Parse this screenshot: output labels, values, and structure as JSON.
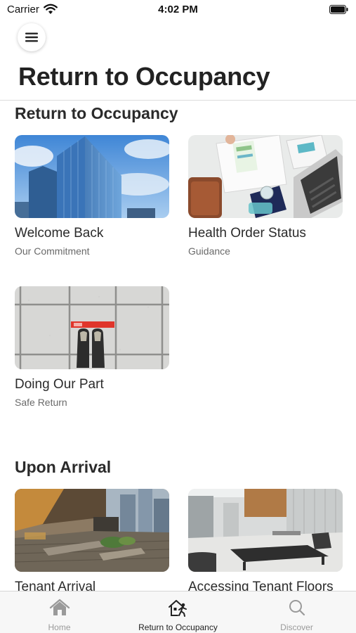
{
  "status_bar": {
    "carrier": "Carrier",
    "time": "4:02 PM"
  },
  "header": {
    "title": "Return to Occupancy",
    "menu_icon": "hamburger-menu-icon"
  },
  "sections": [
    {
      "title": "Return to Occupancy",
      "cards": [
        {
          "title": "Welcome Back",
          "subtitle": "Our Commitment",
          "image": "office-tower-photo"
        },
        {
          "title": "Health Order Status",
          "subtitle": "Guidance",
          "image": "desk-documents-photo"
        },
        {
          "title": "Doing Our Part",
          "subtitle": "Safe Return",
          "image": "floor-distance-marker-photo"
        }
      ]
    },
    {
      "title": "Upon Arrival",
      "cards": [
        {
          "title": "Tenant Arrival",
          "image": "plaza-entrance-photo"
        },
        {
          "title": "Accessing Tenant Floors",
          "image": "lobby-interior-photo"
        }
      ]
    }
  ],
  "tab_bar": {
    "tabs": [
      {
        "label": "Home",
        "icon": "home-icon",
        "active": false
      },
      {
        "label": "Return to Occupancy",
        "icon": "building-walk-icon",
        "active": true
      },
      {
        "label": "Discover",
        "icon": "search-icon",
        "active": false
      }
    ]
  },
  "colors": {
    "active_tab": "#222222",
    "inactive_tab": "#9a9a9a",
    "marker_red": "#e0352b"
  }
}
